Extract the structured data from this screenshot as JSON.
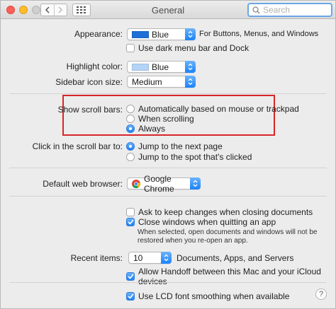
{
  "window": {
    "title": "General"
  },
  "search": {
    "placeholder": "Search"
  },
  "appearance": {
    "label": "Appearance:",
    "value": "Blue",
    "swatch_color": "#1f6fd6",
    "caption": "For Buttons, Menus, and Windows",
    "dark_menu_label": "Use dark menu bar and Dock",
    "dark_menu_checked": false
  },
  "highlight": {
    "label": "Highlight color:",
    "value": "Blue",
    "swatch_color": "#b3d3f7"
  },
  "sidebar_icon": {
    "label": "Sidebar icon size:",
    "value": "Medium"
  },
  "scroll_bars": {
    "label": "Show scroll bars:",
    "options": [
      {
        "label": "Automatically based on mouse or trackpad",
        "selected": false
      },
      {
        "label": "When scrolling",
        "selected": false
      },
      {
        "label": "Always",
        "selected": true
      }
    ]
  },
  "scroll_click": {
    "label": "Click in the scroll bar to:",
    "options": [
      {
        "label": "Jump to the next page",
        "selected": true
      },
      {
        "label": "Jump to the spot that's clicked",
        "selected": false
      }
    ]
  },
  "browser": {
    "label": "Default web browser:",
    "value": "Google Chrome"
  },
  "documents": {
    "ask_keep_label": "Ask to keep changes when closing documents",
    "ask_keep_checked": false,
    "close_windows_label": "Close windows when quitting an app",
    "close_windows_checked": true,
    "note_line1": "When selected, open documents and windows will not be",
    "note_line2": "restored when you re-open an app."
  },
  "recent": {
    "label": "Recent items:",
    "value": "10",
    "caption": "Documents, Apps, and Servers"
  },
  "handoff": {
    "label": "Allow Handoff between this Mac and your iCloud devices",
    "checked": true
  },
  "lcd": {
    "label": "Use LCD font smoothing when available",
    "checked": true
  },
  "help": {
    "glyph": "?"
  },
  "colors": {
    "accent": "#1a82fb",
    "highlight_box": "#d8262a"
  }
}
